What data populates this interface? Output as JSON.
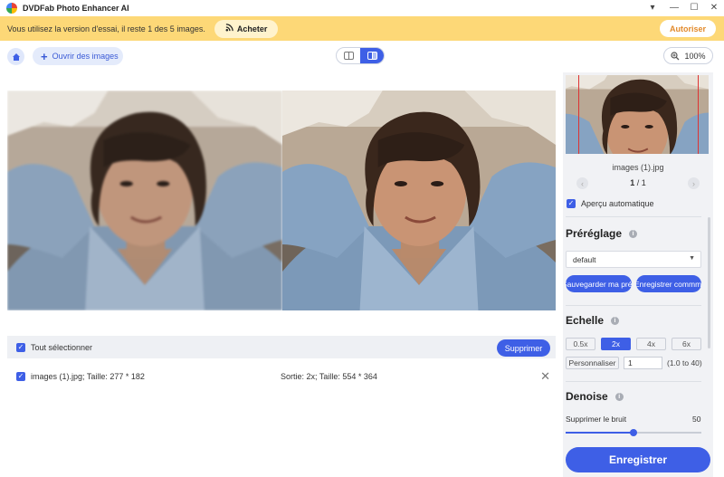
{
  "window": {
    "title": "DVDFab Photo Enhancer AI",
    "controls": [
      "▾",
      "—",
      "☐",
      "✕"
    ]
  },
  "banner": {
    "message": "Vous utilisez la version d'essai, il reste 1 des 5 images.",
    "buy_label": "Acheter",
    "authorize_label": "Autoriser"
  },
  "toolbar": {
    "home_icon": "home-icon",
    "open_label": "Ouvrir des images",
    "zoom_label": "100%",
    "view_mode": "split"
  },
  "file_list": {
    "select_all_label": "Tout sélectionner",
    "delete_label": "Supprimer",
    "items": [
      {
        "name": "images (1).jpg; Taille: 277 * 182",
        "output": "Sortie: 2x; Taille: 554 * 364",
        "checked": true
      }
    ]
  },
  "panel": {
    "thumbnail_name": "images (1).jpg",
    "page_current": "1",
    "page_sep": " / ",
    "page_total": "1",
    "auto_preview_label": "Aperçu automatique",
    "preset": {
      "title": "Préréglage",
      "selected": "default",
      "save_preset_label": "Sauvegarder ma préréglage",
      "save_command_label": "Enregistrer commmande"
    },
    "scale": {
      "title": "Echelle",
      "options": [
        "0.5x",
        "2x",
        "4x",
        "6x"
      ],
      "selected": "2x",
      "custom_label": "Personnaliser",
      "custom_value": "1",
      "custom_range": "(1.0 to 40)"
    },
    "denoise": {
      "title": "Denoise",
      "label": "Supprimer le bruit",
      "value": "50",
      "level_fraction": 0.5
    },
    "save_label": "Enregistrer"
  },
  "colors": {
    "accent": "#3e5fe6",
    "banner": "#fdd877",
    "authorize": "#e28a2c",
    "panel": "#f1f2f5"
  }
}
